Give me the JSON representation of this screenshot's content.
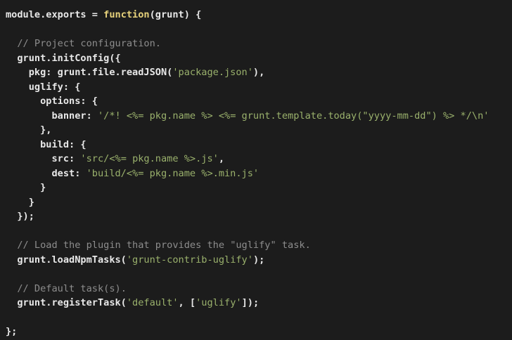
{
  "editor": {
    "language": "javascript",
    "colors": {
      "background": "#1c1c1c",
      "plain": "#e8e8e8",
      "comment": "#8d8d8d",
      "string": "#9ab16c",
      "keyword": "#e7d27b"
    },
    "lines": [
      [
        {
          "t": "plain",
          "v": "module.exports = "
        },
        {
          "t": "keyword",
          "v": "function"
        },
        {
          "t": "plain",
          "v": "(grunt) {"
        }
      ],
      [],
      [
        {
          "t": "plain",
          "v": "  "
        },
        {
          "t": "comment",
          "v": "// Project configuration."
        }
      ],
      [
        {
          "t": "plain",
          "v": "  grunt.initConfig({"
        }
      ],
      [
        {
          "t": "plain",
          "v": "    pkg: grunt.file.readJSON("
        },
        {
          "t": "string",
          "v": "'package.json'"
        },
        {
          "t": "plain",
          "v": "),"
        }
      ],
      [
        {
          "t": "plain",
          "v": "    uglify: {"
        }
      ],
      [
        {
          "t": "plain",
          "v": "      options: {"
        }
      ],
      [
        {
          "t": "plain",
          "v": "        banner: "
        },
        {
          "t": "string",
          "v": "'/*! <%= pkg.name %> <%= grunt.template.today(\"yyyy-mm-dd\") %> */\\n'"
        }
      ],
      [
        {
          "t": "plain",
          "v": "      },"
        }
      ],
      [
        {
          "t": "plain",
          "v": "      build: {"
        }
      ],
      [
        {
          "t": "plain",
          "v": "        src: "
        },
        {
          "t": "string",
          "v": "'src/<%= pkg.name %>.js'"
        },
        {
          "t": "plain",
          "v": ","
        }
      ],
      [
        {
          "t": "plain",
          "v": "        dest: "
        },
        {
          "t": "string",
          "v": "'build/<%= pkg.name %>.min.js'"
        }
      ],
      [
        {
          "t": "plain",
          "v": "      }"
        }
      ],
      [
        {
          "t": "plain",
          "v": "    }"
        }
      ],
      [
        {
          "t": "plain",
          "v": "  });"
        }
      ],
      [],
      [
        {
          "t": "plain",
          "v": "  "
        },
        {
          "t": "comment",
          "v": "// Load the plugin that provides the \"uglify\" task."
        }
      ],
      [
        {
          "t": "plain",
          "v": "  grunt.loadNpmTasks("
        },
        {
          "t": "string",
          "v": "'grunt-contrib-uglify'"
        },
        {
          "t": "plain",
          "v": ");"
        }
      ],
      [],
      [
        {
          "t": "plain",
          "v": "  "
        },
        {
          "t": "comment",
          "v": "// Default task(s)."
        }
      ],
      [
        {
          "t": "plain",
          "v": "  grunt.registerTask("
        },
        {
          "t": "string",
          "v": "'default'"
        },
        {
          "t": "plain",
          "v": ", ["
        },
        {
          "t": "string",
          "v": "'uglify'"
        },
        {
          "t": "plain",
          "v": "]);"
        }
      ],
      [],
      [
        {
          "t": "plain",
          "v": "};"
        }
      ]
    ]
  }
}
